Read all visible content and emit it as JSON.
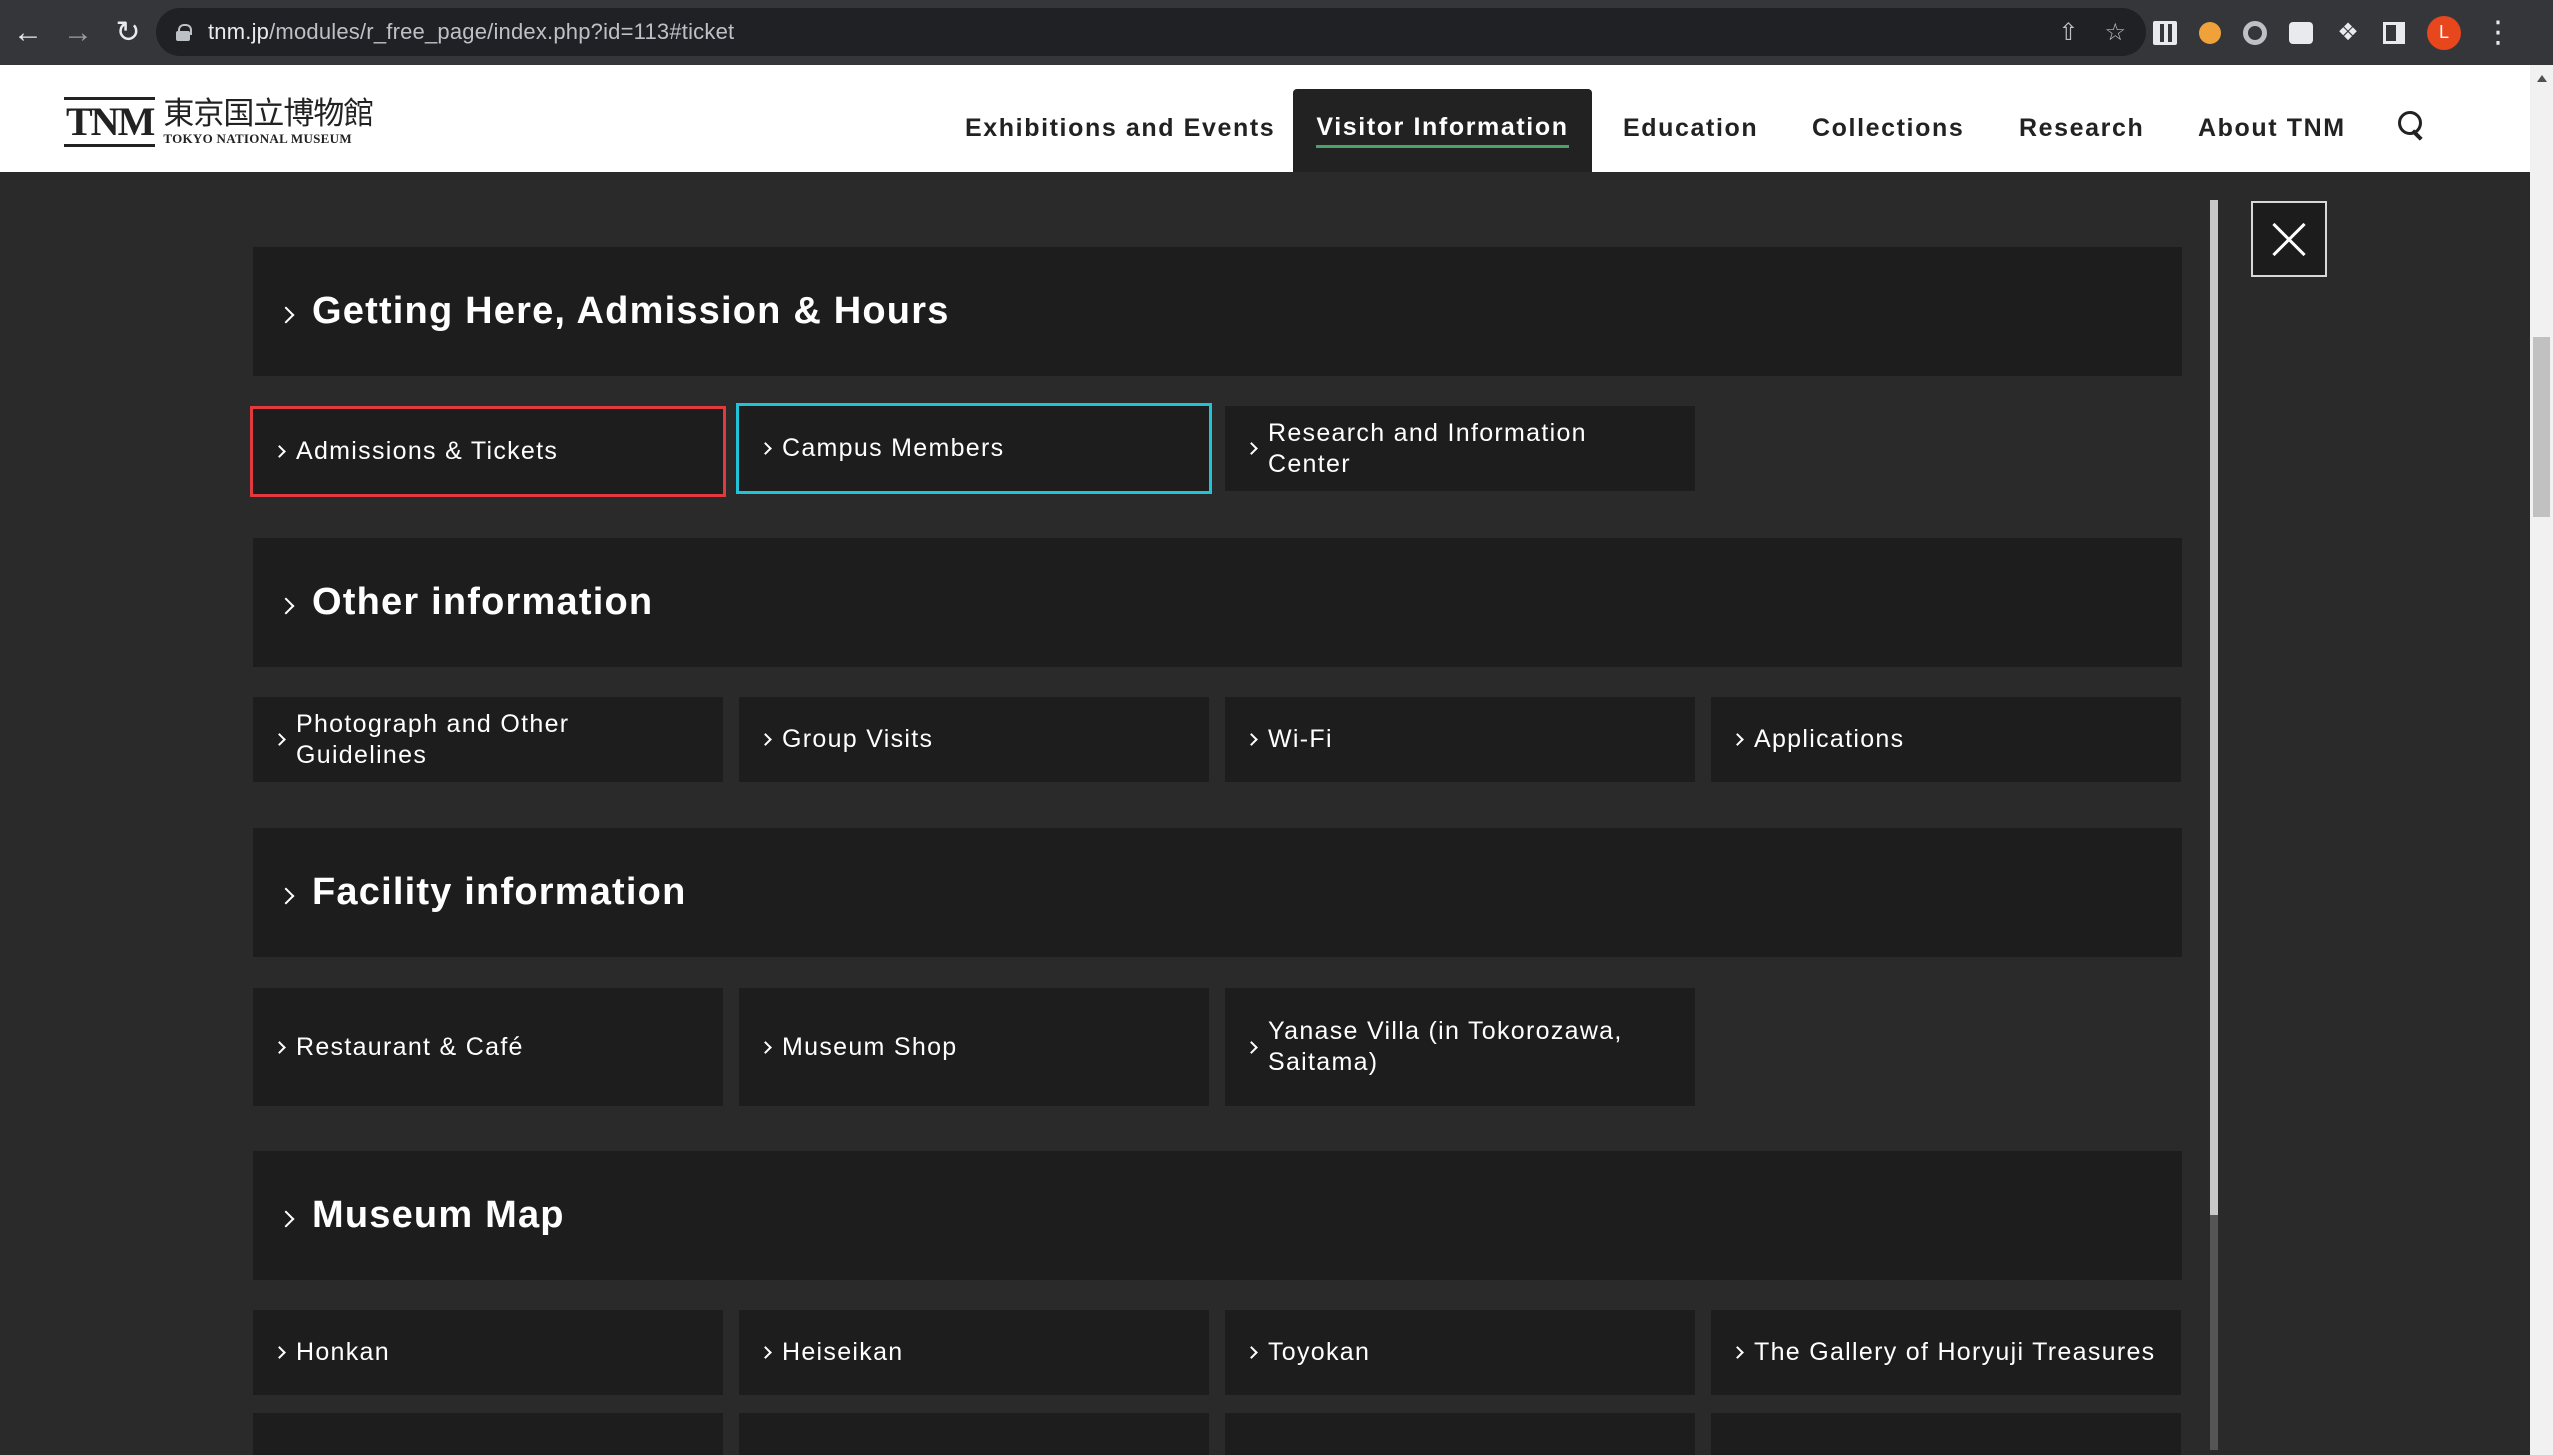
{
  "browser": {
    "url_host": "tnm.jp",
    "url_path": "/modules/r_free_page/index.php?id=113#ticket",
    "profile_initial": "L"
  },
  "header": {
    "logo_mark": "TNM",
    "logo_jp": "東京国立博物館",
    "logo_en": "TOKYO NATIONAL MUSEUM",
    "nav": {
      "exhibitions": "Exhibitions and Events",
      "visitor": "Visitor Information",
      "education": "Education",
      "collections": "Collections",
      "research": "Research",
      "about": "About TNM"
    }
  },
  "menu": {
    "getting_here": {
      "title": "Getting Here, Admission & Hours",
      "items": [
        "Admissions & Tickets",
        "Campus Members",
        "Research and Information Center"
      ]
    },
    "other": {
      "title": "Other information",
      "items": [
        "Photograph and Other Guidelines",
        "Group Visits",
        "Wi-Fi",
        "Applications"
      ]
    },
    "facility": {
      "title": "Facility information",
      "items": [
        "Restaurant & Café",
        "Museum Shop",
        "Yanase Villa (in Tokorozawa, Saitama)"
      ]
    },
    "map": {
      "title": "Museum Map",
      "items": [
        "Honkan",
        "Heiseikan",
        "Toyokan",
        "The Gallery of Horyuji Treasures"
      ]
    }
  },
  "colors": {
    "focus_red": "#e0393e",
    "focus_cyan": "#22c3d6",
    "active_underline": "#4aa36a"
  }
}
